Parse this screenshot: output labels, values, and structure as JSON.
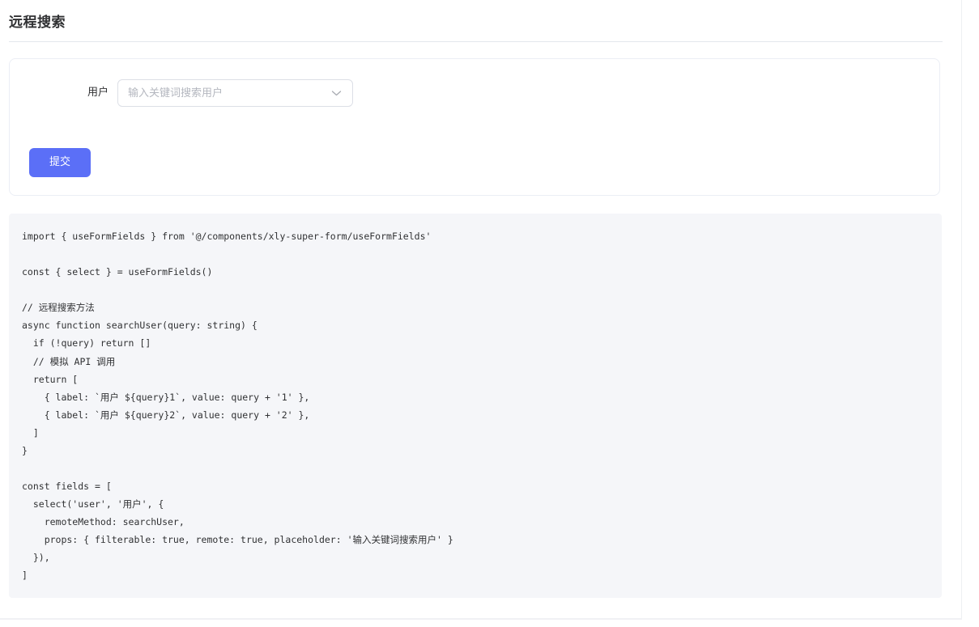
{
  "page": {
    "title": "远程搜索"
  },
  "form": {
    "user_label": "用户",
    "user_select": {
      "value": "",
      "placeholder": "输入关键词搜索用户",
      "icon": "chevron-down-icon"
    },
    "submit_label": "提交"
  },
  "code": {
    "text": "import { useFormFields } from '@/components/xly-super-form/useFormFields'\n\nconst { select } = useFormFields()\n\n// 远程搜索方法\nasync function searchUser(query: string) {\n  if (!query) return []\n  // 模拟 API 调用\n  return [\n    { label: `用户 ${query}1`, value: query + '1' },\n    { label: `用户 ${query}2`, value: query + '2' },\n  ]\n}\n\nconst fields = [\n  select('user', '用户', {\n    remoteMethod: searchUser,\n    props: { filterable: true, remote: true, placeholder: '输入关键词搜索用户' }\n  }),\n]"
  },
  "colors": {
    "primary": "#5b6ff7",
    "code_background": "#f5f6f9",
    "border": "#dcdfe6",
    "placeholder": "#b4b7bf"
  }
}
